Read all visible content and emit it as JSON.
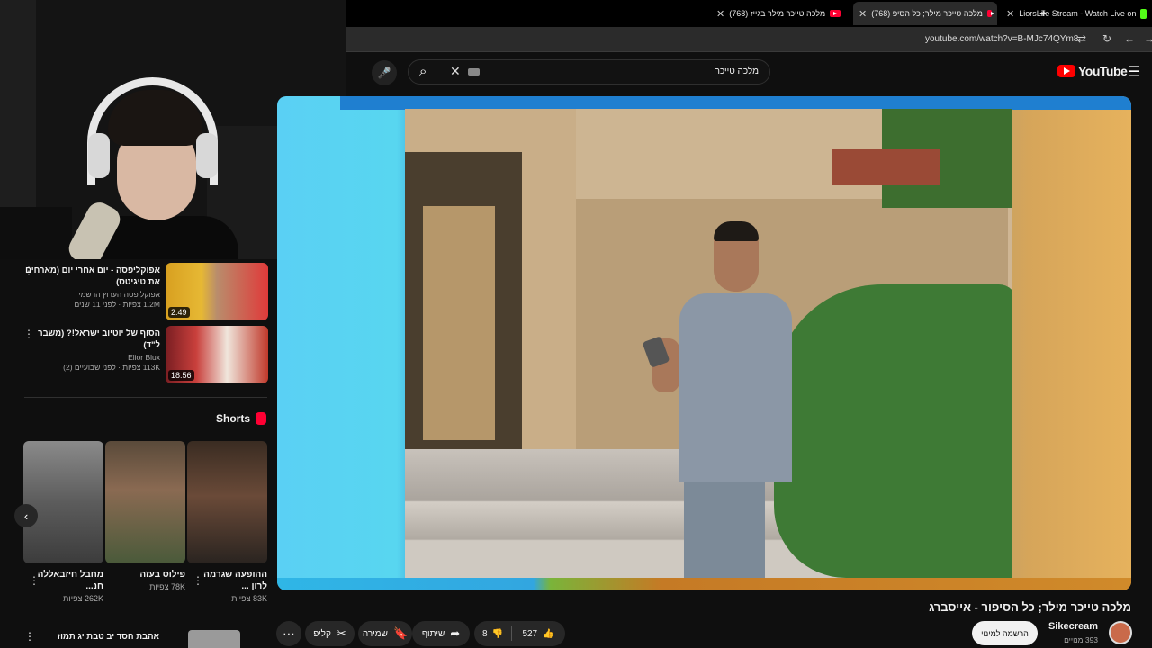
{
  "browser": {
    "tabs": [
      {
        "title": "LiorsLife Stream - Watch Live on"
      },
      {
        "title": "(768) מלכה טייכר מילר; כל הסיפ"
      },
      {
        "title": "(768) מלכה טייכר מילר בגייז"
      }
    ],
    "url": "youtube.com/watch?v=B-MJc74QYm8"
  },
  "masthead": {
    "search_query": "מלכה טייכר",
    "logo_text": "YouTube"
  },
  "related": [
    {
      "title": "אפוקליפסה - יום אחרי יום (מארחים את טיגיטס)",
      "channel": "אפוקליפסה הערוץ הרשמי",
      "meta": "1.2M צפיות · לפני 11 שנים",
      "duration": "2:49"
    },
    {
      "title": "הסוף של יוטיוב ישראל!? (משבר ל\"ד)",
      "channel": "Elior Blux",
      "meta": "113K צפיות · לפני שבועיים (2)",
      "duration": "18:56"
    }
  ],
  "shorts": {
    "heading": "Shorts",
    "items": [
      {
        "title": "ההופעה שגרמה לרון ...",
        "views": "83K צפיות"
      },
      {
        "title": "פילוס בעזה",
        "views": "78K צפיות"
      },
      {
        "title": "מחבל חיזבאללה חנ...",
        "views": "262K צפיות"
      }
    ]
  },
  "bottom_item": {
    "title": "אהבת חסד יב טבת יג תמוז"
  },
  "video": {
    "title": "מלכה טייכר מילר; כל הסיפור - אייסברג",
    "channel": "Sikecream",
    "subscribers": "393 מנויים",
    "subscribe_label": "הרשמה למינוי",
    "likes": "527",
    "dislikes": "8",
    "share_label": "שיתוף",
    "save_label": "שמירה",
    "clip_label": "קליפ"
  },
  "colors": {
    "accent": "#ff0033",
    "background": "#0f0f0f",
    "pill": "#272727"
  }
}
